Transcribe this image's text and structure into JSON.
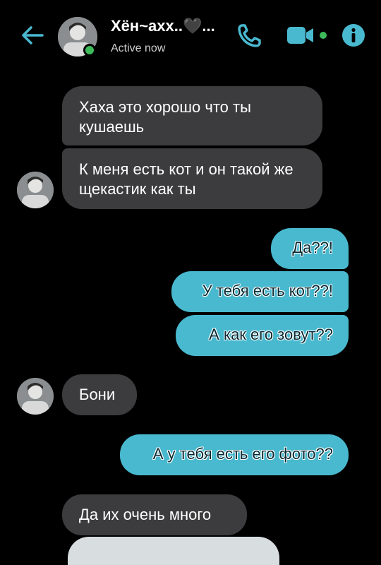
{
  "header": {
    "name": "Хён~ахх..🖤...",
    "status": "Active now",
    "icons": [
      "back-arrow-icon",
      "phone-icon",
      "video-camera-icon",
      "info-icon"
    ],
    "accent": "#49b9cf"
  },
  "messages": [
    {
      "side": "incoming",
      "text": "Хаха это хорошо что ты кушаешь"
    },
    {
      "side": "incoming",
      "text": "К меня есть кот и он такой же щекастик как ты"
    },
    {
      "side": "outgoing",
      "text": "Да??!"
    },
    {
      "side": "outgoing",
      "text": "У тебя есть кот??!"
    },
    {
      "side": "outgoing",
      "text": "А как его зовут??"
    },
    {
      "side": "incoming",
      "text": "Бони"
    },
    {
      "side": "outgoing",
      "text": "А у тебя есть его фото??"
    },
    {
      "side": "incoming",
      "text": "Да их очень много"
    }
  ],
  "colors": {
    "incoming_bubble": "#3c3c3e",
    "outgoing_bubble": "#49b9cf",
    "background": "#000000"
  }
}
